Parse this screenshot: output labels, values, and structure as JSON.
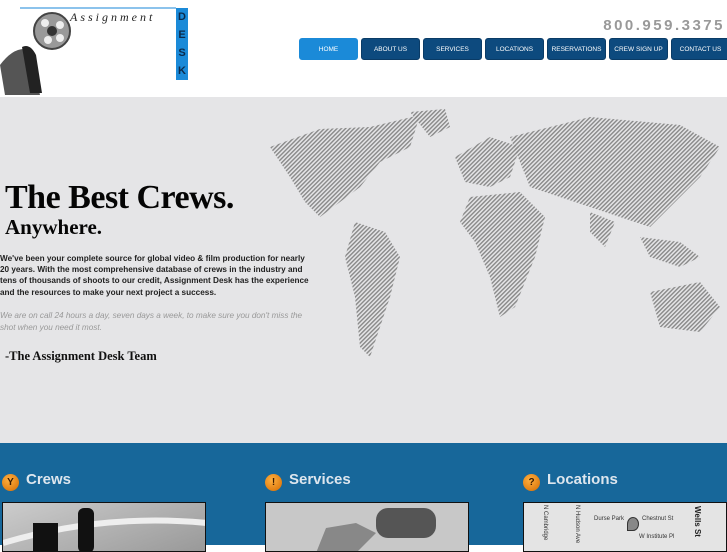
{
  "logo": {
    "word": "Assignment",
    "desk": "DESK"
  },
  "header": {
    "phone": "800.959.3375"
  },
  "nav": [
    "HOME",
    "ABOUT US",
    "SERVICES",
    "LOCATIONS",
    "RESERVATIONS",
    "CREW SIGN UP",
    "CONTACT US"
  ],
  "hero": {
    "title": "The Best Crews.",
    "subtitle": "Anywhere.",
    "intro": "We've been your complete source for global video & film production for nearly 20 years. With the most comprehensive database of crews in the industry and tens of thousands of shoots to our credit, Assignment Desk has the experience and the resources to make your next project a success.",
    "note": "We are on call 24 hours a day, seven days a week, to make sure you don't miss the shot when you need it most.",
    "signature": "-The Assignment Desk Team"
  },
  "sections": [
    {
      "title": "Crews",
      "icon": "wrench-icon"
    },
    {
      "title": "Services",
      "icon": "bulb-icon"
    },
    {
      "title": "Locations",
      "icon": "question-icon"
    }
  ],
  "map_labels": {
    "park": "Durse Park",
    "street1": "Chestnut St",
    "street2": "W Institute Pl",
    "street3": "N Cambridge",
    "street4": "N Hudson Ave",
    "street5": "Wells St"
  },
  "colors": {
    "nav": "#0d4a7e",
    "nav_active": "#1b8ad8",
    "band": "#17679a"
  }
}
